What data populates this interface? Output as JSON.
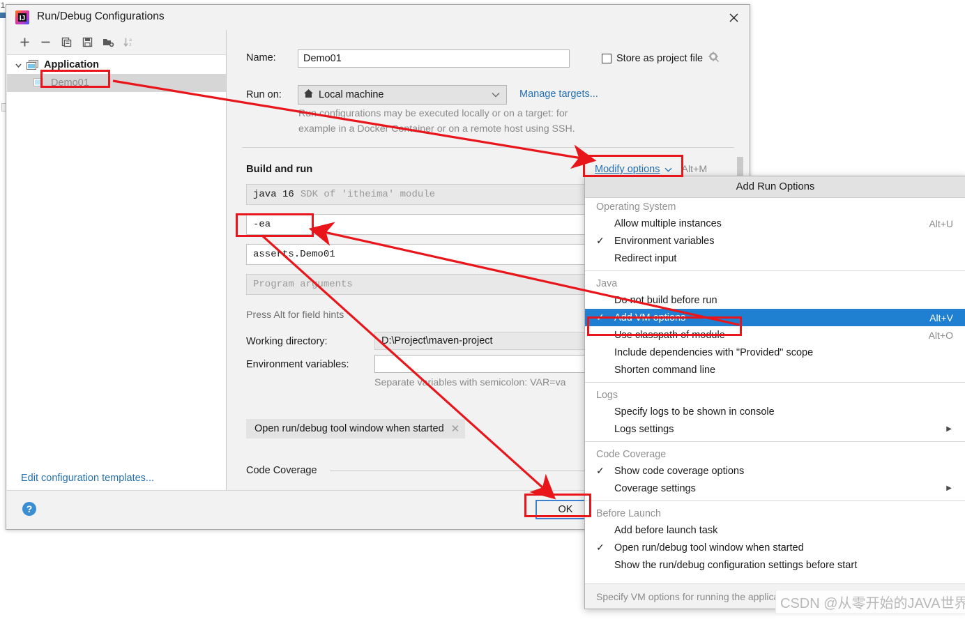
{
  "window": {
    "title": "Run/Debug Configurations",
    "app_icon": "intellij-idea-icon",
    "close_icon": "close-icon"
  },
  "toolbar": {
    "buttons": [
      {
        "name": "add-configuration",
        "icon": "plus-icon"
      },
      {
        "name": "remove-configuration",
        "icon": "minus-icon"
      },
      {
        "name": "copy-configuration",
        "icon": "copy-icon"
      },
      {
        "name": "save-configuration",
        "icon": "save-icon"
      },
      {
        "name": "move-into-folder",
        "icon": "folder-add-icon"
      },
      {
        "name": "sort-configurations",
        "icon": "sort-az-icon"
      }
    ]
  },
  "tree": {
    "group_label": "Application",
    "group_icon": "application-icon",
    "chevron_icon": "chevron-down-icon",
    "child_label": "Demo01",
    "child_icon": "application-icon"
  },
  "left_panel": {
    "edit_templates_link": "Edit configuration templates..."
  },
  "form": {
    "name_label": "Name:",
    "name_value": "Demo01",
    "store_as_project_file": "Store as project file",
    "gear_icon": "gear-icon",
    "run_on_label": "Run on:",
    "run_on_value": "Local machine",
    "run_on_icon": "home-icon",
    "manage_targets_link": "Manage targets...",
    "run_on_hint_line1": "Run configurations may be executed locally or on a target: for",
    "run_on_hint_line2": "example in a Docker Container or on a remote host using SSH.",
    "build_and_run_title": "Build and run",
    "modify_options_link": "Modify options",
    "modify_options_shortcut": "Alt+M",
    "jdk_value": "java 16",
    "jdk_hint": "SDK of 'itheima' module",
    "vm_options_value": "-ea",
    "main_class_value": "asserts.Demo01",
    "program_arguments_placeholder": "Program arguments",
    "field_hints_text": "Press Alt for field hints",
    "working_directory_label": "Working directory:",
    "working_directory_value": "D:\\Project\\maven-project",
    "environment_variables_label": "Environment variables:",
    "environment_variables_value": "",
    "env_hint": "Separate variables with semicolon: VAR=va",
    "chip_label": "Open run/debug tool window when started",
    "chip_close_icon": "close-small-icon",
    "code_coverage_title": "Code Coverage"
  },
  "footer": {
    "help_icon": "help-icon",
    "ok_label": "OK"
  },
  "popup": {
    "title": "Add Run Options",
    "footer_hint": "Specify VM options for running the application",
    "groups": [
      {
        "label": "Operating System",
        "items": [
          {
            "label": "Allow multiple instances",
            "checked": false,
            "shortcut": "Alt+U",
            "submenu": false
          },
          {
            "label": "Environment variables",
            "checked": true,
            "shortcut": "",
            "submenu": false
          },
          {
            "label": "Redirect input",
            "checked": false,
            "shortcut": "",
            "submenu": false
          }
        ]
      },
      {
        "label": "Java",
        "items": [
          {
            "label": "Do not build before run",
            "checked": false,
            "shortcut": "",
            "submenu": false
          },
          {
            "label": "Add VM options",
            "checked": true,
            "shortcut": "Alt+V",
            "submenu": false,
            "selected": true
          },
          {
            "label": "Use classpath of module",
            "checked": false,
            "shortcut": "Alt+O",
            "submenu": false
          },
          {
            "label": "Include dependencies with \"Provided\" scope",
            "checked": false,
            "shortcut": "",
            "submenu": false
          },
          {
            "label": "Shorten command line",
            "checked": false,
            "shortcut": "",
            "submenu": false
          }
        ]
      },
      {
        "label": "Logs",
        "items": [
          {
            "label": "Specify logs to be shown in console",
            "checked": false,
            "shortcut": "",
            "submenu": false
          },
          {
            "label": "Logs settings",
            "checked": false,
            "shortcut": "",
            "submenu": true
          }
        ]
      },
      {
        "label": "Code Coverage",
        "items": [
          {
            "label": "Show code coverage options",
            "checked": true,
            "shortcut": "",
            "submenu": false
          },
          {
            "label": "Coverage settings",
            "checked": false,
            "shortcut": "",
            "submenu": true
          }
        ]
      },
      {
        "label": "Before Launch",
        "items": [
          {
            "label": "Add before launch task",
            "checked": false,
            "shortcut": "",
            "submenu": false
          },
          {
            "label": "Open run/debug tool window when started",
            "checked": true,
            "shortcut": "",
            "submenu": false
          },
          {
            "label": "Show the run/debug configuration settings before start",
            "checked": false,
            "shortcut": "",
            "submenu": false
          }
        ]
      }
    ]
  },
  "annotations": {
    "color": "#e8161a",
    "boxes": [
      "tree-demo01",
      "modify-options",
      "vm-options-field",
      "add-vm-options-item",
      "ok-button"
    ],
    "arrows": [
      "demo01-to-modify-options",
      "vm-options-to-add-vm-options",
      "vm-options-to-ok"
    ]
  },
  "watermark": {
    "text": "CSDN @从零开始的JAVA世界"
  },
  "background": {
    "line_number": "1"
  }
}
